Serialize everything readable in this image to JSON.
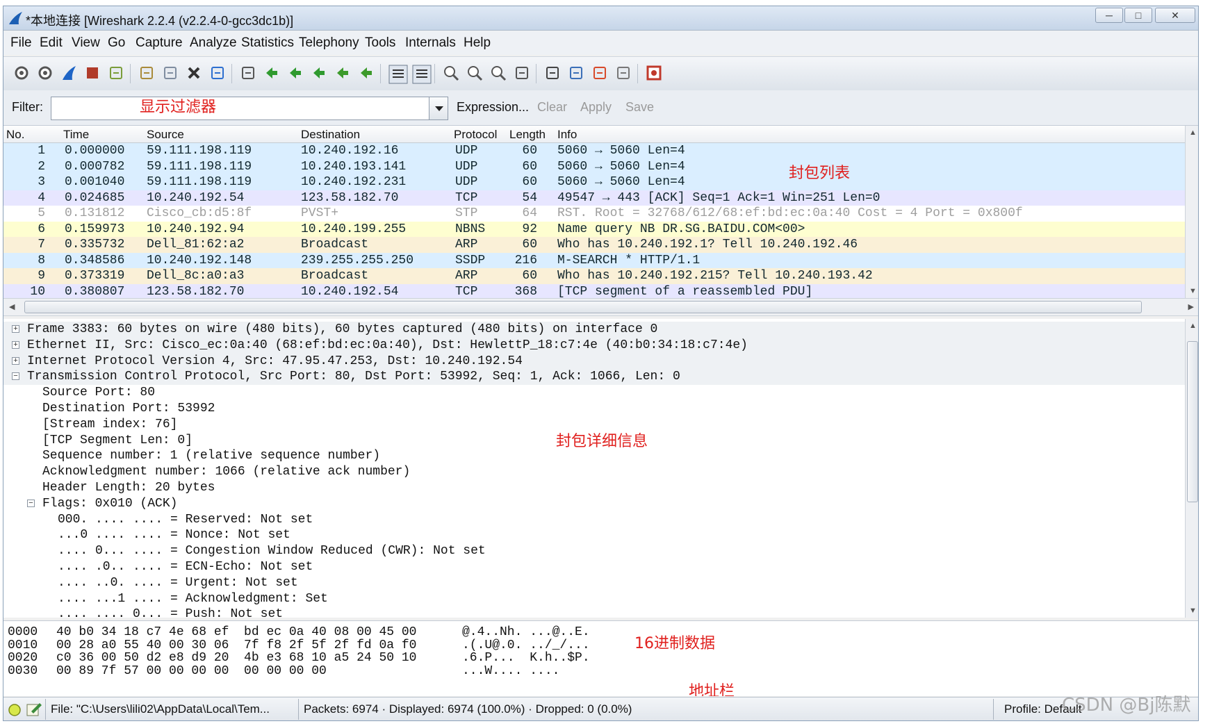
{
  "window": {
    "title": "*本地连接 [Wireshark 2.2.4 (v2.2.4-0-gcc3dc1b)]"
  },
  "menu": [
    "File",
    "Edit",
    "View",
    "Go",
    "Capture",
    "Analyze",
    "Statistics",
    "Telephony",
    "Tools",
    "Internals",
    "Help"
  ],
  "toolbar": {
    "icons": [
      "interfaces-icon",
      "options-icon",
      "start-capture-icon",
      "stop-capture-icon",
      "restart-capture-icon",
      "open-file-icon",
      "save-file-icon",
      "close-file-icon",
      "reload-icon",
      "find-icon",
      "go-back-icon",
      "go-forward-icon",
      "go-to-packet-icon",
      "first-packet-icon",
      "last-packet-icon",
      "colorize-icon",
      "autoscroll-icon",
      "zoom-in-icon",
      "zoom-out-icon",
      "zoom-normal-icon",
      "resize-columns-icon",
      "capture-filters-icon",
      "display-filters-icon",
      "coloring-rules-icon",
      "preferences-icon",
      "help-icon"
    ]
  },
  "filter": {
    "label": "Filter:",
    "value": "",
    "expression": "Expression...",
    "clear": "Clear",
    "apply": "Apply",
    "save": "Save"
  },
  "annotations": {
    "filter": "显示过滤器",
    "packet_list": "封包列表",
    "packet_details": "封包详细信息",
    "hex": "16进制数据",
    "address": "地址栏"
  },
  "packet_list": {
    "columns": [
      "No.",
      "Time",
      "Source",
      "Destination",
      "Protocol",
      "Length",
      "Info"
    ],
    "rows": [
      {
        "no": "1",
        "time": "0.000000",
        "src": "59.111.198.119",
        "dst": "10.240.192.16",
        "proto": "UDP",
        "len": "60",
        "info": "5060 → 5060 Len=4",
        "bg": "#daeeff",
        "fg": "#12272e"
      },
      {
        "no": "2",
        "time": "0.000782",
        "src": "59.111.198.119",
        "dst": "10.240.193.141",
        "proto": "UDP",
        "len": "60",
        "info": "5060 → 5060 Len=4",
        "bg": "#daeeff",
        "fg": "#12272e"
      },
      {
        "no": "3",
        "time": "0.001040",
        "src": "59.111.198.119",
        "dst": "10.240.192.231",
        "proto": "UDP",
        "len": "60",
        "info": "5060 → 5060 Len=4",
        "bg": "#daeeff",
        "fg": "#12272e"
      },
      {
        "no": "4",
        "time": "0.024685",
        "src": "10.240.192.54",
        "dst": "123.58.182.70",
        "proto": "TCP",
        "len": "54",
        "info": "49547 → 443 [ACK] Seq=1 Ack=1 Win=251 Len=0",
        "bg": "#e7e6ff",
        "fg": "#12272e"
      },
      {
        "no": "5",
        "time": "0.131812",
        "src": "Cisco_cb:d5:8f",
        "dst": "PVST+",
        "proto": "STP",
        "len": "64",
        "info": "RST. Root = 32768/612/68:ef:bd:ec:0a:40  Cost = 4  Port = 0x800f",
        "bg": "#ffffff",
        "fg": "#9e9e9e"
      },
      {
        "no": "6",
        "time": "0.159973",
        "src": "10.240.192.94",
        "dst": "10.240.199.255",
        "proto": "NBNS",
        "len": "92",
        "info": "Name query NB DR.SG.BAIDU.COM<00>",
        "bg": "#fefed0",
        "fg": "#12272e"
      },
      {
        "no": "7",
        "time": "0.335732",
        "src": "Dell_81:62:a2",
        "dst": "Broadcast",
        "proto": "ARP",
        "len": "60",
        "info": "Who has 10.240.192.1? Tell 10.240.192.46",
        "bg": "#faf0d7",
        "fg": "#12272e"
      },
      {
        "no": "8",
        "time": "0.348586",
        "src": "10.240.192.148",
        "dst": "239.255.255.250",
        "proto": "SSDP",
        "len": "216",
        "info": "M-SEARCH * HTTP/1.1",
        "bg": "#daeeff",
        "fg": "#12272e"
      },
      {
        "no": "9",
        "time": "0.373319",
        "src": "Dell_8c:a0:a3",
        "dst": "Broadcast",
        "proto": "ARP",
        "len": "60",
        "info": "Who has 10.240.192.215? Tell 10.240.193.42",
        "bg": "#faf0d7",
        "fg": "#12272e"
      },
      {
        "no": "10",
        "time": "0.380807",
        "src": "123.58.182.70",
        "dst": "10.240.192.54",
        "proto": "TCP",
        "len": "368",
        "info": "[TCP segment of a reassembled PDU]",
        "bg": "#e7e6ff",
        "fg": "#12272e"
      }
    ]
  },
  "details": [
    {
      "indent": 0,
      "exp": "+",
      "text": "Frame 3383: 60 bytes on wire (480 bits), 60 bytes captured (480 bits) on interface 0",
      "shade": true
    },
    {
      "indent": 0,
      "exp": "+",
      "text": "Ethernet II, Src: Cisco_ec:0a:40 (68:ef:bd:ec:0a:40), Dst: HewlettP_18:c7:4e (40:b0:34:18:c7:4e)",
      "shade": true
    },
    {
      "indent": 0,
      "exp": "+",
      "text": "Internet Protocol Version 4, Src: 47.95.47.253, Dst: 10.240.192.54",
      "shade": true
    },
    {
      "indent": 0,
      "exp": "-",
      "text": "Transmission Control Protocol, Src Port: 80, Dst Port: 53992, Seq: 1, Ack: 1066, Len: 0",
      "shade": true
    },
    {
      "indent": 1,
      "exp": "",
      "text": "Source Port: 80",
      "shade": false
    },
    {
      "indent": 1,
      "exp": "",
      "text": "Destination Port: 53992",
      "shade": false
    },
    {
      "indent": 1,
      "exp": "",
      "text": "[Stream index: 76]",
      "shade": false
    },
    {
      "indent": 1,
      "exp": "",
      "text": "[TCP Segment Len: 0]",
      "shade": false
    },
    {
      "indent": 1,
      "exp": "",
      "text": "Sequence number: 1    (relative sequence number)",
      "shade": false
    },
    {
      "indent": 1,
      "exp": "",
      "text": "Acknowledgment number: 1066    (relative ack number)",
      "shade": false
    },
    {
      "indent": 1,
      "exp": "",
      "text": "Header Length: 20 bytes",
      "shade": false
    },
    {
      "indent": 1,
      "exp": "-",
      "text": "Flags: 0x010 (ACK)",
      "shade": false
    },
    {
      "indent": 2,
      "exp": "",
      "text": "000. .... .... = Reserved: Not set",
      "shade": false
    },
    {
      "indent": 2,
      "exp": "",
      "text": "...0 .... .... = Nonce: Not set",
      "shade": false
    },
    {
      "indent": 2,
      "exp": "",
      "text": ".... 0... .... = Congestion Window Reduced (CWR): Not set",
      "shade": false
    },
    {
      "indent": 2,
      "exp": "",
      "text": ".... .0.. .... = ECN-Echo: Not set",
      "shade": false
    },
    {
      "indent": 2,
      "exp": "",
      "text": ".... ..0. .... = Urgent: Not set",
      "shade": false
    },
    {
      "indent": 2,
      "exp": "",
      "text": ".... ...1 .... = Acknowledgment: Set",
      "shade": false
    },
    {
      "indent": 2,
      "exp": "",
      "text": ".... .... 0... = Push: Not set",
      "shade": false
    }
  ],
  "hex": [
    {
      "offset": "0000",
      "bytes": "40 b0 34 18 c7 4e 68 ef  bd ec 0a 40 08 00 45 00",
      "ascii": "@.4..Nh. ...@..E."
    },
    {
      "offset": "0010",
      "bytes": "00 28 a0 55 40 00 30 06  7f f8 2f 5f 2f fd 0a f0",
      "ascii": ".(.U@.0. ../_/..."
    },
    {
      "offset": "0020",
      "bytes": "c0 36 00 50 d2 e8 d9 20  4b e3 68 10 a5 24 50 10",
      "ascii": ".6.P...  K.h..$P."
    },
    {
      "offset": "0030",
      "bytes": "00 89 7f 57 00 00 00 00  00 00 00 00",
      "ascii": "...W.... ...."
    }
  ],
  "status": {
    "file": "File: \"C:\\Users\\lili02\\AppData\\Local\\Tem...",
    "packets": "Packets: 6974 · Displayed: 6974 (100.0%) · Dropped: 0 (0.0%)",
    "profile": "Profile: Default"
  },
  "watermark": "CSDN @Bj陈默"
}
